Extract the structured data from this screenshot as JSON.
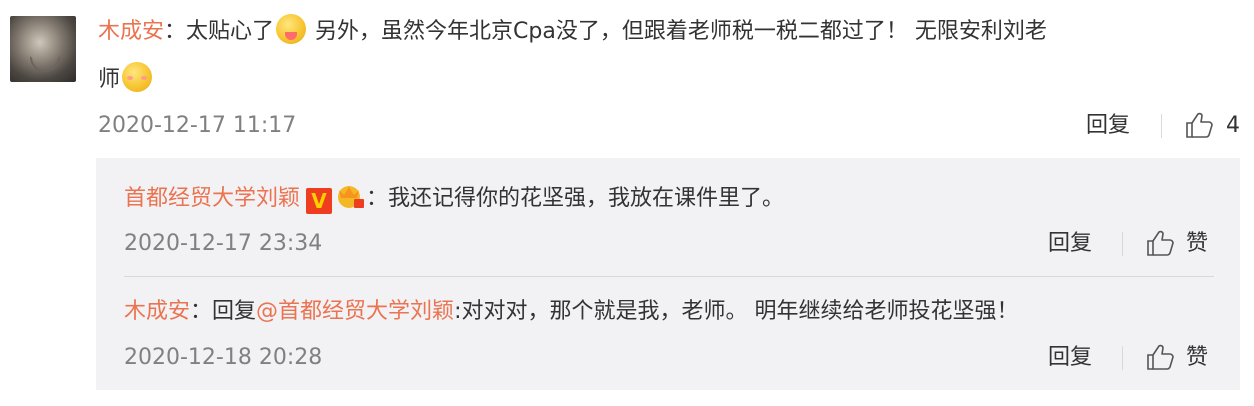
{
  "comment": {
    "author": "木成安",
    "colon": "：",
    "text_part1": "太贴心了",
    "text_part2": " 另外，虽然今年北京Cpa没了，但跟着老师税一税二都过了！ 无限安利刘老",
    "text_part3": "师",
    "time": "2020-12-17 11:17",
    "reply_label": "回复",
    "like_count": "4"
  },
  "sub_replies": [
    {
      "author": "首都经贸大学刘颖",
      "verified_badge": "V",
      "colon": "：",
      "text": "我还记得你的花坚强，我放在课件里了。",
      "time": "2020-12-17 23:34",
      "reply_label": "回复",
      "like_label": "赞"
    },
    {
      "author": "木成安",
      "colon": "：",
      "reply_prefix": "回复",
      "mention": "@首都经贸大学刘颖",
      "text": ":对对对，那个就是我，老师。 明年继续给老师投花坚强！",
      "time": "2020-12-18 20:28",
      "reply_label": "回复",
      "like_label": "赞"
    }
  ],
  "colors": {
    "name": "#eb7350",
    "time": "#808080",
    "reply_box": "#f2f2f5",
    "badge": "#ee3e1f"
  },
  "icons": [
    "tongue-emoji-icon",
    "shy-emoji-icon",
    "crown-badge-icon",
    "thumbs-up-icon"
  ]
}
